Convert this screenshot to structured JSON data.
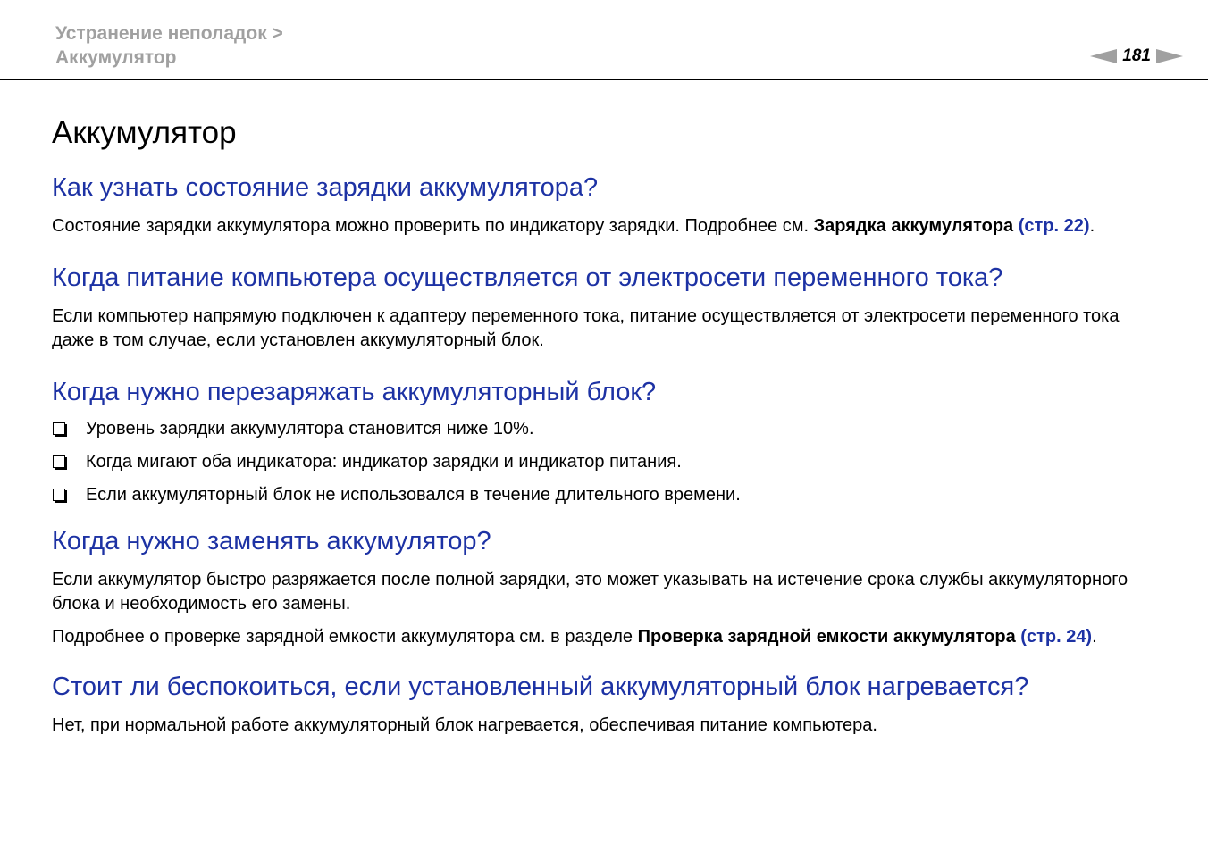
{
  "header": {
    "breadcrumb_line1": "Устранение неполадок >",
    "breadcrumb_line2": "Аккумулятор",
    "page_number": "181"
  },
  "title": "Аккумулятор",
  "sections": [
    {
      "heading": "Как узнать состояние зарядки аккумулятора?",
      "text": "Состояние зарядки аккумулятора можно проверить по индикатору зарядки. Подробнее см.",
      "ref_bold": "Зарядка аккумулятора",
      "ref_link": "(стр. 22)",
      "tail": "."
    },
    {
      "heading": "Когда питание компьютера осуществляется от электросети переменного тока?",
      "text": "Если компьютер напрямую подключен к адаптеру переменного тока, питание осуществляется от электросети переменного тока даже в том случае, если установлен аккумуляторный блок."
    },
    {
      "heading": "Когда нужно перезаряжать аккумуляторный блок?",
      "bullets": [
        "Уровень зарядки аккумулятора становится ниже 10%.",
        "Когда мигают оба индикатора: индикатор зарядки и индикатор питания.",
        "Если аккумуляторный блок не использовался в течение длительного времени."
      ]
    },
    {
      "heading": "Когда нужно заменять аккумулятор?",
      "text": "Если аккумулятор быстро разряжается после полной зарядки, это может указывать на истечение срока службы аккумуляторного блока и необходимость его замены.",
      "text2": "Подробнее о проверке зарядной емкости аккумулятора см. в разделе",
      "ref_bold": "Проверка зарядной емкости аккумулятора",
      "ref_link": "(стр. 24)",
      "tail": "."
    },
    {
      "heading": "Стоит ли беспокоиться, если установленный аккумуляторный блок нагревается?",
      "text": "Нет, при нормальной работе аккумуляторный блок нагревается, обеспечивая питание компьютера."
    }
  ],
  "colors": {
    "heading_blue": "#1d32a4",
    "header_gray": "#a0a0a0"
  }
}
